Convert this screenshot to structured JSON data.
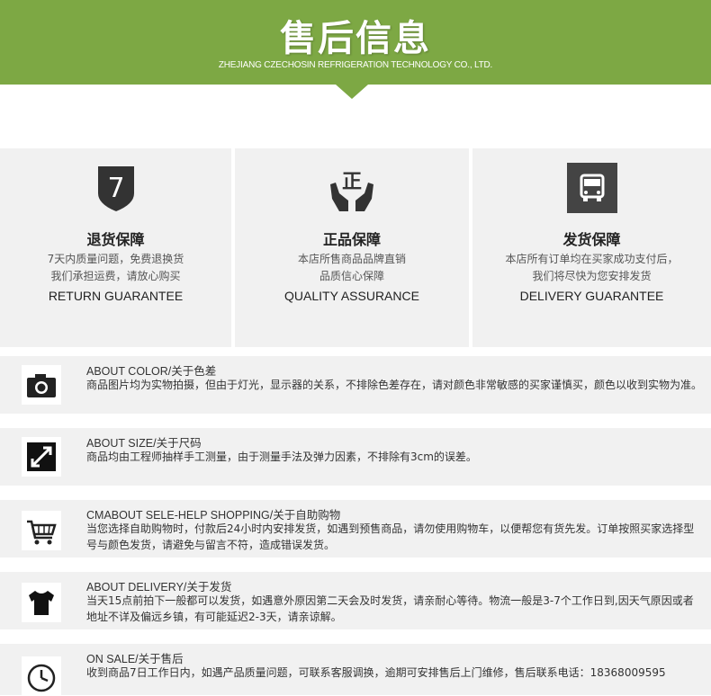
{
  "header": {
    "title": "售后信息",
    "subtitle": "ZHEJIANG CZECHOSIN REFRIGERATION TECHNOLOGY CO., LTD."
  },
  "guarantees": [
    {
      "icon": "shield-7-icon",
      "title": "退货保障",
      "line1": "7天内质量问题，免费退换货",
      "line2": "我们承担运费，请放心购买",
      "english": "RETURN GUARANTEE"
    },
    {
      "icon": "authentic-hands-icon",
      "title": "正品保障",
      "line1": "本店所售商品品牌直销",
      "line2": "品质信心保障",
      "english": "QUALITY ASSURANCE"
    },
    {
      "icon": "delivery-truck-icon",
      "title": "发货保障",
      "line1": "本店所有订单均在买家成功支付后，",
      "line2": "我们将尽快为您安排发货",
      "english": "DELIVERY GUARANTEE"
    }
  ],
  "info_rows": [
    {
      "icon": "camera-icon",
      "title": "ABOUT COLOR/关于色差",
      "body": "商品图片均为实物拍摄，但由于灯光，显示器的关系，不排除色差存在，请对颜色非常敏感的买家谨慎买，颜色以收到实物为准。"
    },
    {
      "icon": "resize-arrow-icon",
      "title": "ABOUT SIZE/关于尺码",
      "body": "商品均由工程师抽样手工测量，由于测量手法及弹力因素，不排除有3cm的误差。"
    },
    {
      "icon": "shopping-cart-icon",
      "title": "CMABOUT SELE-HELP SHOPPING/关于自助购物",
      "body": "当您选择自助购物时，付款后24小时内安排发货，如遇到预售商品，请勿使用购物车，以便帮您有货先发。订单按照买家选择型号与颜色发货，请避免与留言不符，造成错误发货。"
    },
    {
      "icon": "tshirt-icon",
      "title": "ABOUT DELIVERY/关于发货",
      "body": "当天15点前拍下一般都可以发货，如遇意外原因第二天会及时发货，请亲耐心等待。物流一般是3-7个工作日到,因天气原因或者地址不详及偏远乡镇，有可能延迟2-3天，请亲谅解。"
    },
    {
      "icon": "clock-icon",
      "title": "ON SALE/关于售后",
      "body": "收到商品7日工作日内，如遇产品质量问题，可联系客服调换，逾期可安排售后上门维修，售后联系电话：18368009595"
    }
  ],
  "colors": {
    "banner": "#7da844",
    "panel": "#f1f1f1",
    "icon_dark": "#333333"
  }
}
